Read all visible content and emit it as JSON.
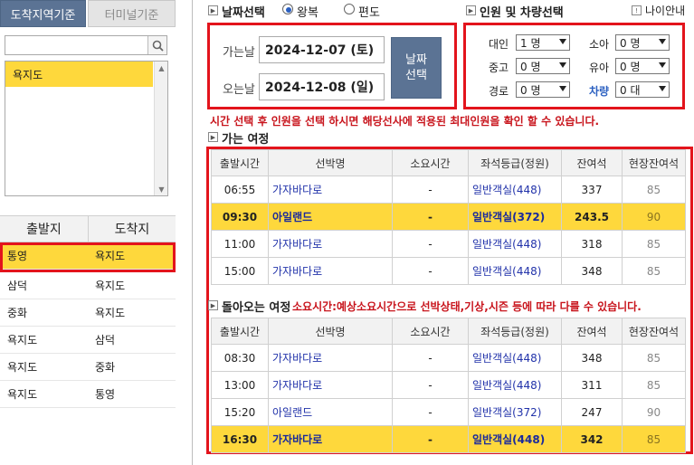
{
  "tabs": {
    "active": "도착지역기준",
    "inactive": "터미널기준"
  },
  "search": {
    "value": ""
  },
  "region_list": {
    "selected": "욕지도"
  },
  "routes": {
    "header_from": "출발지",
    "header_to": "도착지",
    "rows": [
      {
        "from": "통영",
        "to": "욕지도"
      },
      {
        "from": "삼덕",
        "to": "욕지도"
      },
      {
        "from": "중화",
        "to": "욕지도"
      },
      {
        "from": "욕지도",
        "to": "삼덕"
      },
      {
        "from": "욕지도",
        "to": "중화"
      },
      {
        "from": "욕지도",
        "to": "통영"
      }
    ]
  },
  "date_select": {
    "title": "날짜선택",
    "round_trip": "왕복",
    "one_way": "편도",
    "depart_label": "가는날",
    "depart_value": "2024-12-07 (토)",
    "return_label": "오는날",
    "return_value": "2024-12-08 (일)",
    "button_line1": "날짜",
    "button_line2": "선택"
  },
  "people_select": {
    "title": "인원 및 차량선택",
    "age_guide": "나이안내",
    "adult_label": "대인",
    "adult_value": "1 명",
    "child_label": "소아",
    "child_value": "0 명",
    "middle_label": "중고",
    "middle_value": "0 명",
    "infant_label": "유아",
    "infant_value": "0 명",
    "senior_label": "경로",
    "senior_value": "0 명",
    "vehicle_label": "차량",
    "vehicle_value": "0 대"
  },
  "notice": "시간 선택 후 인원을 선택 하시면 해당선사에 적용된 최대인원을 확인 할 수 있습니다.",
  "outbound": {
    "title": "가는 여정",
    "columns": [
      "출발시간",
      "선박명",
      "소요시간",
      "좌석등급(정원)",
      "잔여석",
      "현장잔여석"
    ],
    "rows": [
      {
        "time": "06:55",
        "ship": "가자바다로",
        "duration": "-",
        "grade": "일반객실(448)",
        "remain": "337",
        "onsite": "85"
      },
      {
        "time": "09:30",
        "ship": "아일랜드",
        "duration": "-",
        "grade": "일반객실(372)",
        "remain": "243.5",
        "onsite": "90"
      },
      {
        "time": "11:00",
        "ship": "가자바다로",
        "duration": "-",
        "grade": "일반객실(448)",
        "remain": "318",
        "onsite": "85"
      },
      {
        "time": "15:00",
        "ship": "가자바다로",
        "duration": "-",
        "grade": "일반객실(448)",
        "remain": "348",
        "onsite": "85"
      }
    ]
  },
  "inbound": {
    "title": "돌아오는 여정",
    "note": "소요시간:예상소요시간으로 선박상태,기상,시즌 등에 따라 다를 수 있습니다.",
    "columns": [
      "출발시간",
      "선박명",
      "소요시간",
      "좌석등급(정원)",
      "잔여석",
      "현장잔여석"
    ],
    "rows": [
      {
        "time": "08:30",
        "ship": "가자바다로",
        "duration": "-",
        "grade": "일반객실(448)",
        "remain": "348",
        "onsite": "85"
      },
      {
        "time": "13:00",
        "ship": "가자바다로",
        "duration": "-",
        "grade": "일반객실(448)",
        "remain": "311",
        "onsite": "85"
      },
      {
        "time": "15:20",
        "ship": "아일랜드",
        "duration": "-",
        "grade": "일반객실(372)",
        "remain": "247",
        "onsite": "90"
      },
      {
        "time": "16:30",
        "ship": "가자바다로",
        "duration": "-",
        "grade": "일반객실(448)",
        "remain": "342",
        "onsite": "85"
      }
    ]
  },
  "colors": {
    "highlight": "#fed83c",
    "red_frame": "#e3141c",
    "tab_active": "#5b7394",
    "notice_red": "#c8141c",
    "link_blue": "#2233aa"
  },
  "icons": [
    "search-icon",
    "scroll-up-arrow-icon",
    "scroll-down-arrow-icon",
    "dropdown-arrow-icon",
    "section-marker-icon",
    "info-icon"
  ]
}
